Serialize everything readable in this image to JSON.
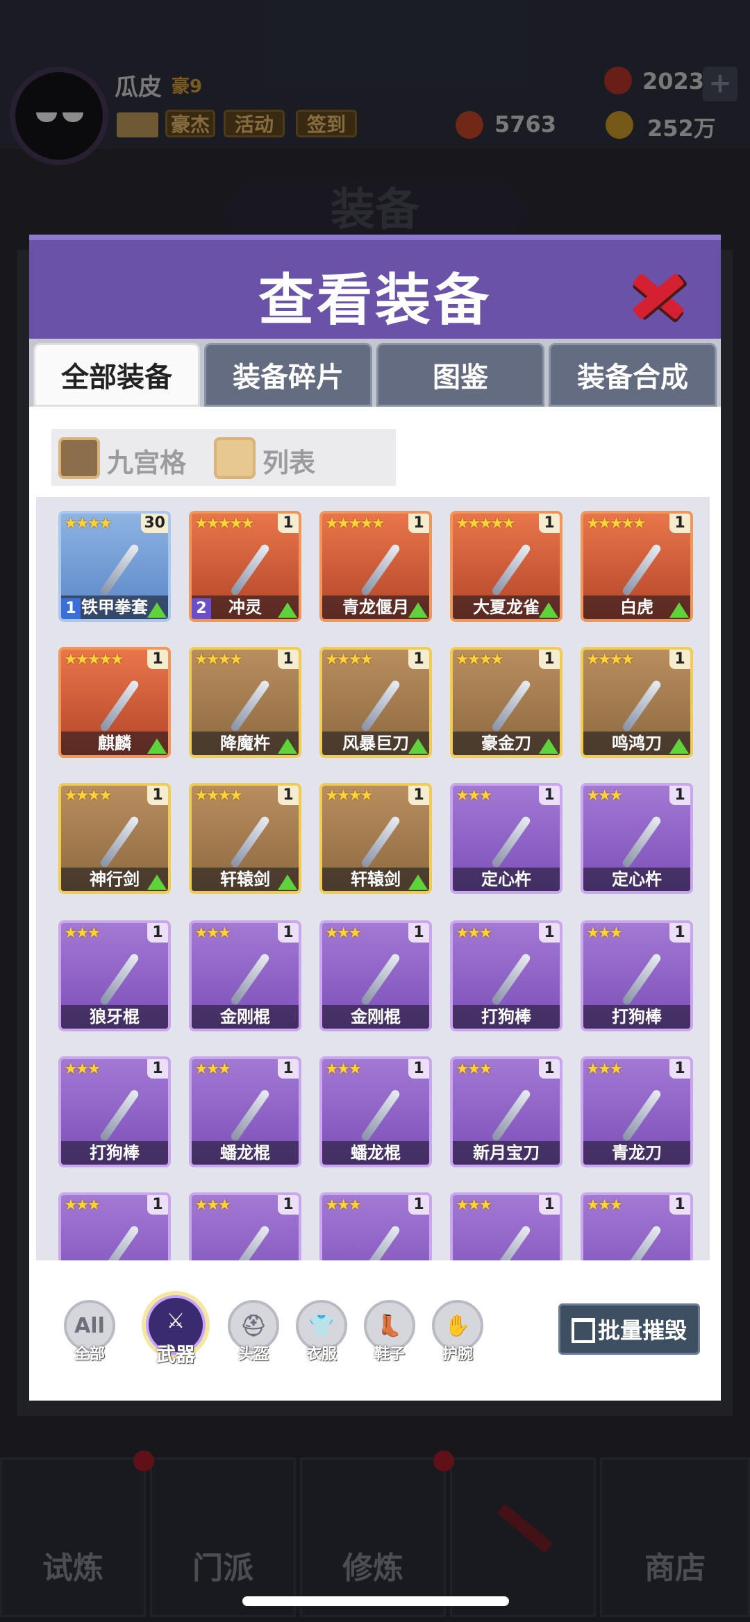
{
  "player": {
    "name": "瓜皮",
    "level": "豪9"
  },
  "top_buttons": [
    "豪杰",
    "活动",
    "签到"
  ],
  "resources": {
    "gems": "2023",
    "tokens": "5763",
    "gold": "252万"
  },
  "background_title": "装备",
  "modal": {
    "title": "查看装备",
    "tabs": [
      "全部装备",
      "装备碎片",
      "图鉴",
      "装备合成"
    ],
    "view_modes": [
      "九宫格",
      "列表"
    ],
    "items": [
      {
        "name": "铁甲拳套",
        "stars": "★★★★",
        "count": "30",
        "rarity": "blue",
        "level": "1",
        "upgrade": true
      },
      {
        "name": "冲灵",
        "stars": "★★★★★",
        "count": "1",
        "rarity": "orange",
        "level": "2",
        "upgrade": true
      },
      {
        "name": "青龙偃月",
        "stars": "★★★★★",
        "count": "1",
        "rarity": "orange",
        "level": "",
        "upgrade": true
      },
      {
        "name": "大夏龙雀",
        "stars": "★★★★★",
        "count": "1",
        "rarity": "orange",
        "level": "",
        "upgrade": true
      },
      {
        "name": "白虎",
        "stars": "★★★★★",
        "count": "1",
        "rarity": "orange",
        "level": "",
        "upgrade": true
      },
      {
        "name": "麒麟",
        "stars": "★★★★★",
        "count": "1",
        "rarity": "orange",
        "level": "",
        "upgrade": true
      },
      {
        "name": "降魔杵",
        "stars": "★★★★",
        "count": "1",
        "rarity": "gold",
        "level": "",
        "upgrade": true
      },
      {
        "name": "风暴巨刀",
        "stars": "★★★★",
        "count": "1",
        "rarity": "gold",
        "level": "",
        "upgrade": true
      },
      {
        "name": "豪金刀",
        "stars": "★★★★",
        "count": "1",
        "rarity": "gold",
        "level": "",
        "upgrade": true
      },
      {
        "name": "鸣鸿刀",
        "stars": "★★★★",
        "count": "1",
        "rarity": "gold",
        "level": "",
        "upgrade": true
      },
      {
        "name": "神行剑",
        "stars": "★★★★",
        "count": "1",
        "rarity": "gold",
        "level": "",
        "upgrade": true
      },
      {
        "name": "轩辕剑",
        "stars": "★★★★",
        "count": "1",
        "rarity": "gold",
        "level": "",
        "upgrade": true
      },
      {
        "name": "轩辕剑",
        "stars": "★★★★",
        "count": "1",
        "rarity": "gold",
        "level": "",
        "upgrade": true
      },
      {
        "name": "定心杵",
        "stars": "★★★",
        "count": "1",
        "rarity": "purple",
        "level": "",
        "upgrade": false
      },
      {
        "name": "定心杵",
        "stars": "★★★",
        "count": "1",
        "rarity": "purple",
        "level": "",
        "upgrade": false
      },
      {
        "name": "狼牙棍",
        "stars": "★★★",
        "count": "1",
        "rarity": "purple",
        "level": "",
        "upgrade": false
      },
      {
        "name": "金刚棍",
        "stars": "★★★",
        "count": "1",
        "rarity": "purple",
        "level": "",
        "upgrade": false
      },
      {
        "name": "金刚棍",
        "stars": "★★★",
        "count": "1",
        "rarity": "purple",
        "level": "",
        "upgrade": false
      },
      {
        "name": "打狗棒",
        "stars": "★★★",
        "count": "1",
        "rarity": "purple",
        "level": "",
        "upgrade": false
      },
      {
        "name": "打狗棒",
        "stars": "★★★",
        "count": "1",
        "rarity": "purple",
        "level": "",
        "upgrade": false
      },
      {
        "name": "打狗棒",
        "stars": "★★★",
        "count": "1",
        "rarity": "purple",
        "level": "",
        "upgrade": false
      },
      {
        "name": "蟠龙棍",
        "stars": "★★★",
        "count": "1",
        "rarity": "purple",
        "level": "",
        "upgrade": false
      },
      {
        "name": "蟠龙棍",
        "stars": "★★★",
        "count": "1",
        "rarity": "purple",
        "level": "",
        "upgrade": false
      },
      {
        "name": "新月宝刀",
        "stars": "★★★",
        "count": "1",
        "rarity": "purple",
        "level": "",
        "upgrade": false
      },
      {
        "name": "青龙刀",
        "stars": "★★★",
        "count": "1",
        "rarity": "purple",
        "level": "",
        "upgrade": false
      },
      {
        "name": "",
        "stars": "★★★",
        "count": "1",
        "rarity": "purple",
        "level": "",
        "upgrade": false
      },
      {
        "name": "",
        "stars": "★★★",
        "count": "1",
        "rarity": "purple",
        "level": "",
        "upgrade": false
      },
      {
        "name": "",
        "stars": "★★★",
        "count": "1",
        "rarity": "purple",
        "level": "",
        "upgrade": false
      },
      {
        "name": "",
        "stars": "★★★",
        "count": "1",
        "rarity": "purple",
        "level": "",
        "upgrade": false
      },
      {
        "name": "",
        "stars": "★★★",
        "count": "1",
        "rarity": "purple",
        "level": "",
        "upgrade": false
      }
    ],
    "filters": [
      {
        "label": "全部",
        "glyph": "All",
        "active": false
      },
      {
        "label": "武器",
        "glyph": "⚔",
        "active": true
      },
      {
        "label": "头盔",
        "glyph": "⛑",
        "active": false
      },
      {
        "label": "衣服",
        "glyph": "👕",
        "active": false
      },
      {
        "label": "鞋子",
        "glyph": "👢",
        "active": false
      },
      {
        "label": "护腕",
        "glyph": "✋",
        "active": false
      }
    ],
    "destroy_label": "批量摧毁"
  },
  "bottom_nav": [
    "试炼",
    "门派",
    "修炼",
    "",
    "商店"
  ],
  "colors": {
    "header_purple": "#6a52a8",
    "close_red": "#d42030",
    "upgrade_green": "#5fd33a",
    "star_gold": "#ffd23b"
  }
}
